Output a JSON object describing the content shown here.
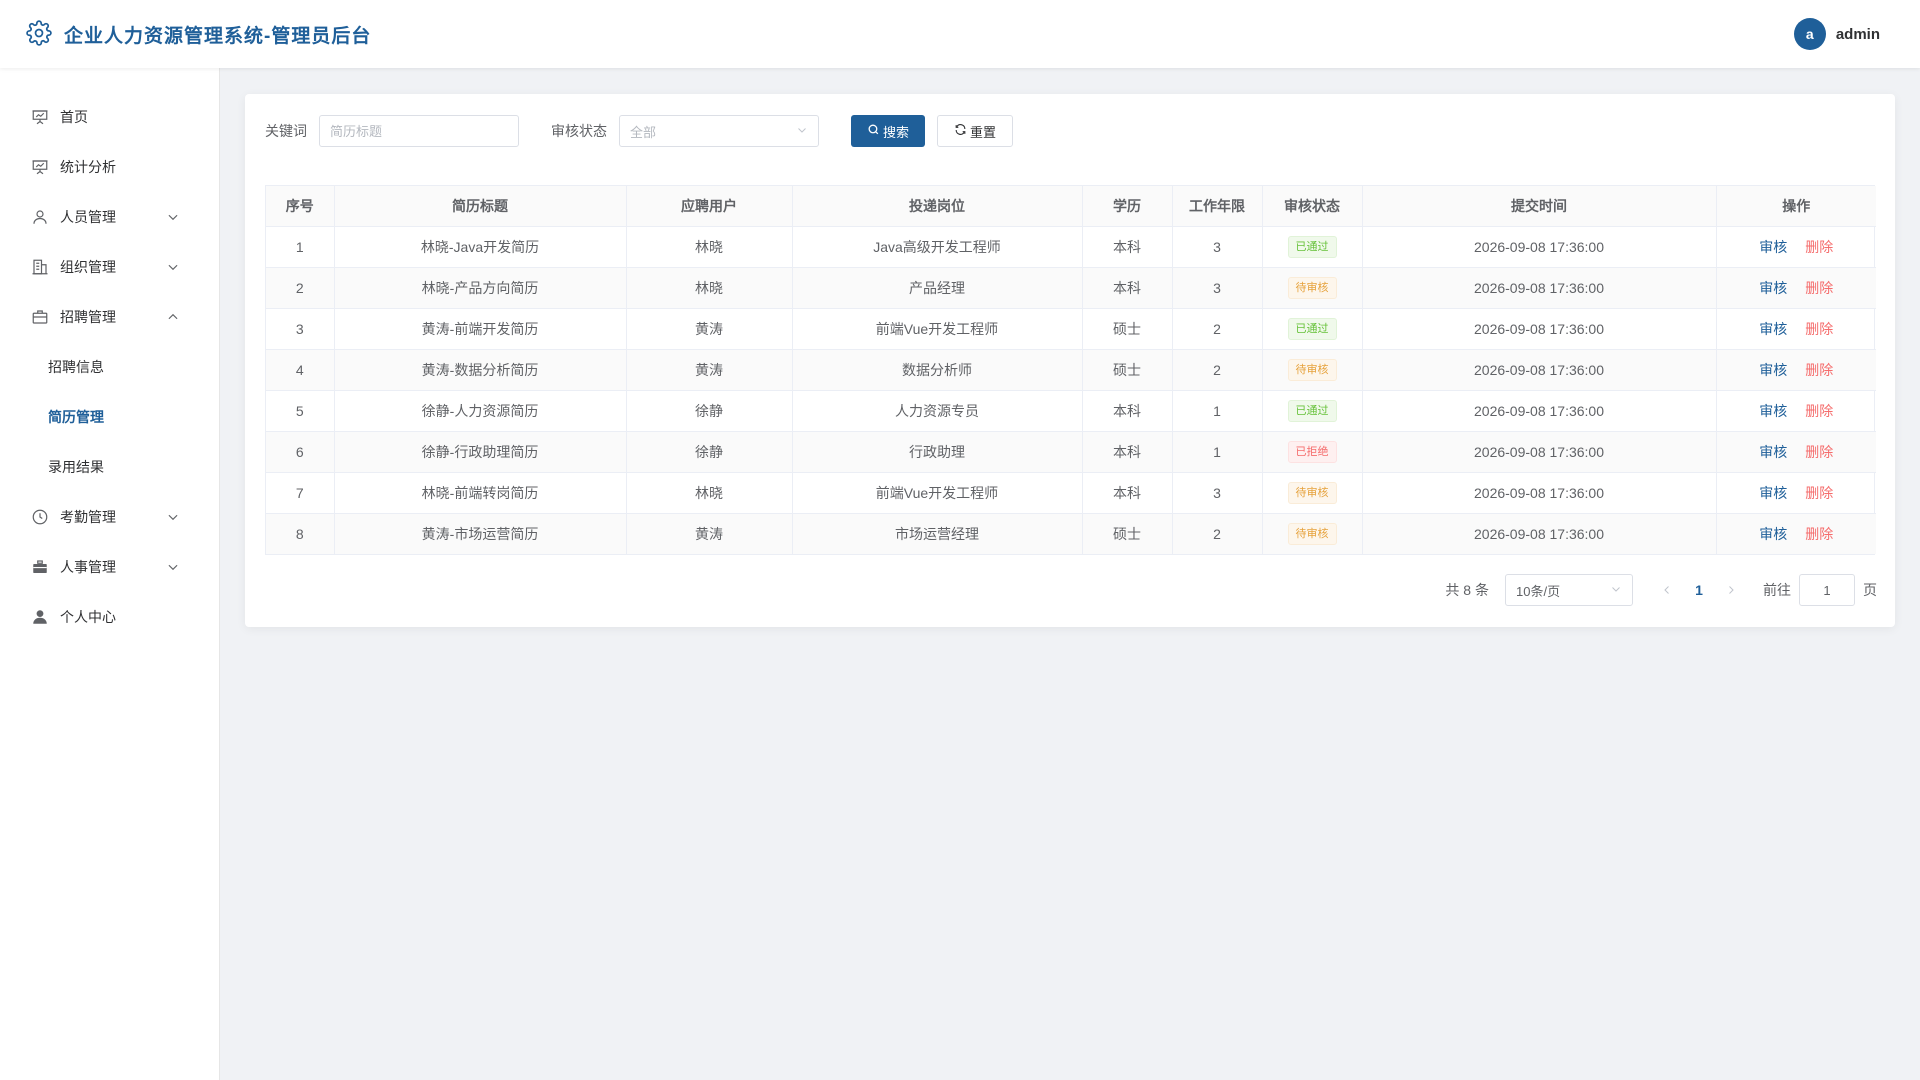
{
  "header": {
    "title": "企业人力资源管理系统-管理员后台",
    "avatar_letter": "a",
    "username": "admin"
  },
  "sidebar": {
    "items": [
      {
        "label": "首页",
        "icon": "presentation-icon"
      },
      {
        "label": "统计分析",
        "icon": "presentation-icon"
      },
      {
        "label": "人员管理",
        "icon": "user-icon",
        "expanded": false
      },
      {
        "label": "组织管理",
        "icon": "office-building-icon",
        "expanded": false
      },
      {
        "label": "招聘管理",
        "icon": "briefcase-icon",
        "expanded": true
      },
      {
        "label": "考勤管理",
        "icon": "clock-icon",
        "expanded": false
      },
      {
        "label": "人事管理",
        "icon": "suitcase-icon",
        "expanded": false
      },
      {
        "label": "个人中心",
        "icon": "user-solid-icon"
      }
    ],
    "recruit_sub": [
      {
        "label": "招聘信息",
        "active": false
      },
      {
        "label": "简历管理",
        "active": true
      },
      {
        "label": "录用结果",
        "active": false
      }
    ]
  },
  "search": {
    "keyword_label": "关键词",
    "keyword_placeholder": "简历标题",
    "keyword_value": "",
    "status_label": "审核状态",
    "status_value": "全部",
    "search_button": "搜索",
    "reset_button": "重置"
  },
  "table": {
    "columns": [
      "序号",
      "简历标题",
      "应聘用户",
      "投递岗位",
      "学历",
      "工作年限",
      "审核状态",
      "提交时间",
      "操作"
    ],
    "rows": [
      {
        "index": "1",
        "title": "林晓-Java开发简历",
        "user": "林晓",
        "position": "Java高级开发工程师",
        "education": "本科",
        "years": "3",
        "status": "已通过",
        "status_type": "approved",
        "time": "2026-09-08 17:36:00"
      },
      {
        "index": "2",
        "title": "林晓-产品方向简历",
        "user": "林晓",
        "position": "产品经理",
        "education": "本科",
        "years": "3",
        "status": "待审核",
        "status_type": "pending",
        "time": "2026-09-08 17:36:00"
      },
      {
        "index": "3",
        "title": "黄涛-前端开发简历",
        "user": "黄涛",
        "position": "前端Vue开发工程师",
        "education": "硕士",
        "years": "2",
        "status": "已通过",
        "status_type": "approved",
        "time": "2026-09-08 17:36:00"
      },
      {
        "index": "4",
        "title": "黄涛-数据分析简历",
        "user": "黄涛",
        "position": "数据分析师",
        "education": "硕士",
        "years": "2",
        "status": "待审核",
        "status_type": "pending",
        "time": "2026-09-08 17:36:00"
      },
      {
        "index": "5",
        "title": "徐静-人力资源简历",
        "user": "徐静",
        "position": "人力资源专员",
        "education": "本科",
        "years": "1",
        "status": "已通过",
        "status_type": "approved",
        "time": "2026-09-08 17:36:00"
      },
      {
        "index": "6",
        "title": "徐静-行政助理简历",
        "user": "徐静",
        "position": "行政助理",
        "education": "本科",
        "years": "1",
        "status": "已拒绝",
        "status_type": "rejected",
        "time": "2026-09-08 17:36:00"
      },
      {
        "index": "7",
        "title": "林晓-前端转岗简历",
        "user": "林晓",
        "position": "前端Vue开发工程师",
        "education": "本科",
        "years": "3",
        "status": "待审核",
        "status_type": "pending",
        "time": "2026-09-08 17:36:00"
      },
      {
        "index": "8",
        "title": "黄涛-市场运营简历",
        "user": "黄涛",
        "position": "市场运营经理",
        "education": "硕士",
        "years": "2",
        "status": "待审核",
        "status_type": "pending",
        "time": "2026-09-08 17:36:00"
      }
    ],
    "actions": {
      "review": "审核",
      "delete": "删除"
    }
  },
  "pagination": {
    "total_text": "共 8 条",
    "page_size": "10条/页",
    "current_page": "1",
    "goto_label": "前往",
    "goto_value": "1",
    "page_suffix": "页"
  },
  "colors": {
    "primary": "#1f5f99",
    "success": "#67c23a",
    "warning": "#e6a23c",
    "danger": "#f56c6c"
  }
}
